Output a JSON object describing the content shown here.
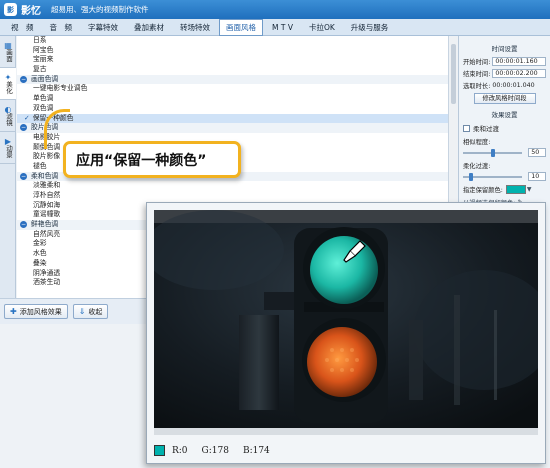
{
  "titlebar": {
    "logo": "影",
    "app_name": "影忆",
    "subtitle": "超易用、强大的视频制作软件"
  },
  "menu": [
    {
      "label": "视　频",
      "active": false
    },
    {
      "label": "音　频",
      "active": false
    },
    {
      "label": "字幕特效",
      "active": false
    },
    {
      "label": "叠加素材",
      "active": false
    },
    {
      "label": "转场特效",
      "active": false
    },
    {
      "label": "画面风格",
      "active": true
    },
    {
      "label": "M T V",
      "active": false
    },
    {
      "label": "卡拉OK",
      "active": false
    },
    {
      "label": "升级与服务",
      "active": false
    }
  ],
  "rail": [
    {
      "label": "画面",
      "icon": "picture-icon",
      "active": false
    },
    {
      "label": "美化",
      "icon": "beautify-icon",
      "active": true
    },
    {
      "label": "滤镜",
      "icon": "filter-icon",
      "active": false
    },
    {
      "label": "动景",
      "icon": "motion-icon",
      "active": false
    }
  ],
  "list": [
    {
      "type": "item",
      "text": "日系"
    },
    {
      "type": "item",
      "text": "阿宝色"
    },
    {
      "type": "item",
      "text": "宝丽来"
    },
    {
      "type": "item",
      "text": "复古"
    },
    {
      "type": "group",
      "text": "画面色调"
    },
    {
      "type": "item",
      "text": "一键电影专业调色"
    },
    {
      "type": "item",
      "text": "单色调"
    },
    {
      "type": "item",
      "text": "双色调"
    },
    {
      "type": "item",
      "text": "保留一种颜色",
      "selected": true
    },
    {
      "type": "group",
      "text": "胶片色调"
    },
    {
      "type": "item",
      "text": "电影胶片"
    },
    {
      "type": "item",
      "text": "颠倒色调"
    },
    {
      "type": "item",
      "text": "胶片影像"
    },
    {
      "type": "item",
      "text": "褪色"
    },
    {
      "type": "group",
      "text": "柔和色调"
    },
    {
      "type": "item",
      "text": "淡雅柔和"
    },
    {
      "type": "item",
      "text": "淳朴自然"
    },
    {
      "type": "item",
      "text": "沉静如海"
    },
    {
      "type": "item",
      "text": "童谣幢歌"
    },
    {
      "type": "group",
      "text": "鲜艳色调"
    },
    {
      "type": "item",
      "text": "自然风亮"
    },
    {
      "type": "item",
      "text": "金彩"
    },
    {
      "type": "item",
      "text": "水色"
    },
    {
      "type": "item",
      "text": "叠染"
    },
    {
      "type": "item",
      "text": "阴净通透"
    },
    {
      "type": "item",
      "text": "洒茶生动"
    }
  ],
  "bottom": {
    "add_label": "添加风格效果",
    "collapse_label": "收起"
  },
  "right": {
    "section1": "时间设置",
    "start_label": "开始时间:",
    "start_value": "00:00:01.160",
    "end_label": "结束时间:",
    "end_value": "00:00:02.200",
    "duration_label": "选取时长:",
    "duration_value": "00:00:01.040",
    "modify_btn": "修改风格时间段",
    "section2": "效果设置",
    "soft_transition": "柔和过渡",
    "similarity_label": "相似程度:",
    "similarity_value": "50",
    "softness_label": "柔化过渡:",
    "softness_value": "10",
    "keep_color_label": "指定保留颜色:",
    "keep_color": "#00b2ae",
    "pick_label": "从视频选保留颜色:"
  },
  "callout": {
    "text": "应用“保留一种颜色”"
  },
  "readout": {
    "color": "#00b2ae",
    "r": "R:0",
    "g": "G:178",
    "b": "B:174"
  },
  "levels": {
    "similarity": 50,
    "softness": 10
  }
}
